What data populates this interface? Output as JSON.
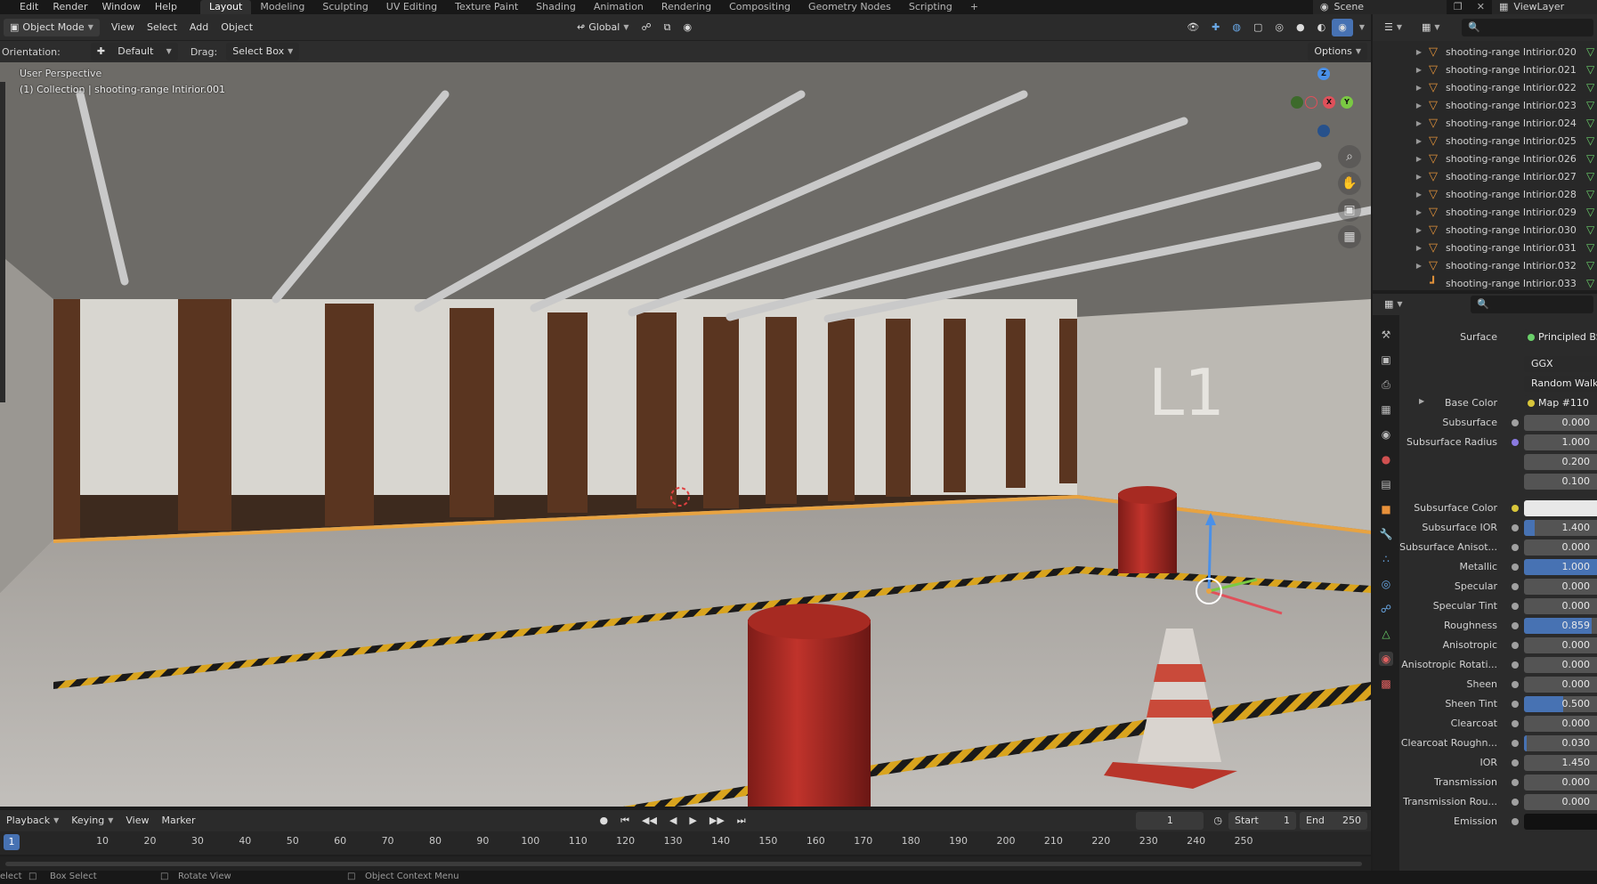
{
  "menu": {
    "items": [
      "Edit",
      "Render",
      "Window",
      "Help"
    ],
    "workspaces": [
      "Layout",
      "Modeling",
      "Sculpting",
      "UV Editing",
      "Texture Paint",
      "Shading",
      "Animation",
      "Rendering",
      "Compositing",
      "Geometry Nodes",
      "Scripting"
    ],
    "active_workspace": "Layout",
    "add_tab": "+",
    "scene_label": "Scene",
    "viewlayer_label": "ViewLayer"
  },
  "viewport_header": {
    "mode": "Object Mode",
    "menus": [
      "View",
      "Select",
      "Add",
      "Object"
    ],
    "transform_orientation": "Global"
  },
  "tool_settings": {
    "orientation_label": "Orientation:",
    "orientation_value": "Default",
    "drag_label": "Drag:",
    "drag_value": "Select Box",
    "options": "Options"
  },
  "viewport": {
    "perspective_label": "User Perspective",
    "collection_label": "(1) Collection | shooting-range Intirior.001",
    "wall_sign": "L1",
    "gizmo": {
      "z": "Z",
      "y": "Y",
      "x": "X"
    }
  },
  "outliner": {
    "items": [
      "shooting-range Intirior.020",
      "shooting-range Intirior.021",
      "shooting-range Intirior.022",
      "shooting-range Intirior.023",
      "shooting-range Intirior.024",
      "shooting-range Intirior.025",
      "shooting-range Intirior.026",
      "shooting-range Intirior.027",
      "shooting-range Intirior.028",
      "shooting-range Intirior.029",
      "shooting-range Intirior.030",
      "shooting-range Intirior.031",
      "shooting-range Intirior.032",
      "shooting-range Intirior.033"
    ]
  },
  "properties": {
    "surface_label": "Surface",
    "surface_value": "Principled BSDF",
    "distribution": "GGX",
    "subsurface_method": "Random Walk",
    "base_color_label": "Base Color",
    "base_color_value": "Map #110",
    "rows": [
      {
        "label": "Subsurface",
        "value": "0.000",
        "fill": 0
      },
      {
        "label": "Subsurface Radius",
        "value": "1.000",
        "fill": 0
      },
      {
        "label": "",
        "value": "0.200",
        "fill": 0
      },
      {
        "label": "",
        "value": "0.100",
        "fill": 0
      },
      {
        "label": "Subsurface Color",
        "value": "",
        "fill": 0
      },
      {
        "label": "Subsurface IOR",
        "value": "1.400",
        "fill": 0.14
      },
      {
        "label": "Subsurface Anisot...",
        "value": "0.000",
        "fill": 0
      },
      {
        "label": "Metallic",
        "value": "1.000",
        "fill": 1
      },
      {
        "label": "Specular",
        "value": "0.000",
        "fill": 0
      },
      {
        "label": "Specular Tint",
        "value": "0.000",
        "fill": 0
      },
      {
        "label": "Roughness",
        "value": "0.859",
        "fill": 0.859
      },
      {
        "label": "Anisotropic",
        "value": "0.000",
        "fill": 0
      },
      {
        "label": "Anisotropic Rotati...",
        "value": "0.000",
        "fill": 0
      },
      {
        "label": "Sheen",
        "value": "0.000",
        "fill": 0
      },
      {
        "label": "Sheen Tint",
        "value": "0.500",
        "fill": 0.5
      },
      {
        "label": "Clearcoat",
        "value": "0.000",
        "fill": 0
      },
      {
        "label": "Clearcoat Roughn...",
        "value": "0.030",
        "fill": 0.03
      },
      {
        "label": "IOR",
        "value": "1.450",
        "fill": 0
      },
      {
        "label": "Transmission",
        "value": "0.000",
        "fill": 0
      },
      {
        "label": "Transmission Rou...",
        "value": "0.000",
        "fill": 0
      },
      {
        "label": "Emission",
        "value": "",
        "fill": 0
      }
    ]
  },
  "timeline": {
    "menus": [
      "Playback",
      "Keying",
      "View",
      "Marker"
    ],
    "current_frame": "1",
    "start_label": "Start",
    "start_value": "1",
    "end_label": "End",
    "end_value": "250",
    "ticks": [
      "10",
      "20",
      "30",
      "40",
      "50",
      "60",
      "70",
      "80",
      "90",
      "100",
      "110",
      "120",
      "130",
      "140",
      "150",
      "160",
      "170",
      "180",
      "190",
      "200",
      "210",
      "220",
      "230",
      "240",
      "250"
    ],
    "playhead": "1"
  },
  "statusbar": {
    "left": "elect",
    "box_select": "Box Select",
    "rotate_view": "Rotate View",
    "context_menu": "Object Context Menu"
  }
}
